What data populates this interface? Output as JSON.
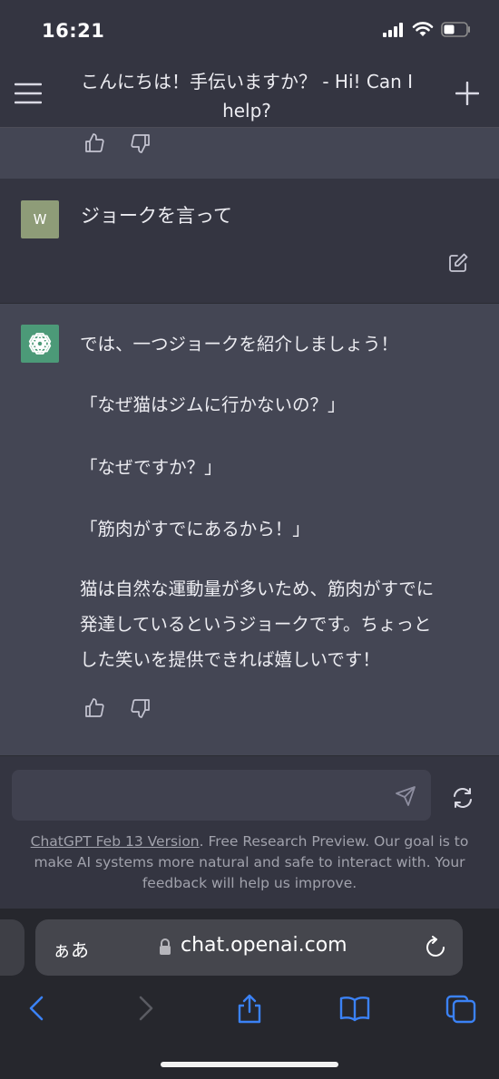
{
  "status_bar": {
    "time": "16:21"
  },
  "nav": {
    "title_line1": "こんにちは！手伝いますか？ - Hi! Can I",
    "title_line2": "help?"
  },
  "user_message": {
    "avatar_letter": "W",
    "text": "ジョークを言って"
  },
  "assistant_message": {
    "paragraphs": [
      "では、一つジョークを紹介しましょう！",
      "「なぜ猫はジムに行かないの？」",
      "「なぜですか？」",
      "「筋肉がすでにあるから！」",
      "猫は自然な運動量が多いため、筋肉がすでに",
      "発達しているというジョークです。ちょっと",
      "した笑いを提供できれば嬉しいです！"
    ]
  },
  "input": {
    "placeholder": ""
  },
  "footer": {
    "link_text": "ChatGPT Feb 13 Version",
    "line1_rest": ". Free Research Preview. Our goal is to",
    "line2": "make AI systems more natural and safe to interact with. Your",
    "line3": "feedback will help us improve."
  },
  "browser": {
    "aa_label": "ぁあ",
    "url": "chat.openai.com"
  },
  "colors": {
    "background": "#343541",
    "assistant_bg": "#444654",
    "gpt_green": "#4c9a78",
    "user_avatar": "#8e9c78",
    "safari_blue": "#3b82f6"
  }
}
